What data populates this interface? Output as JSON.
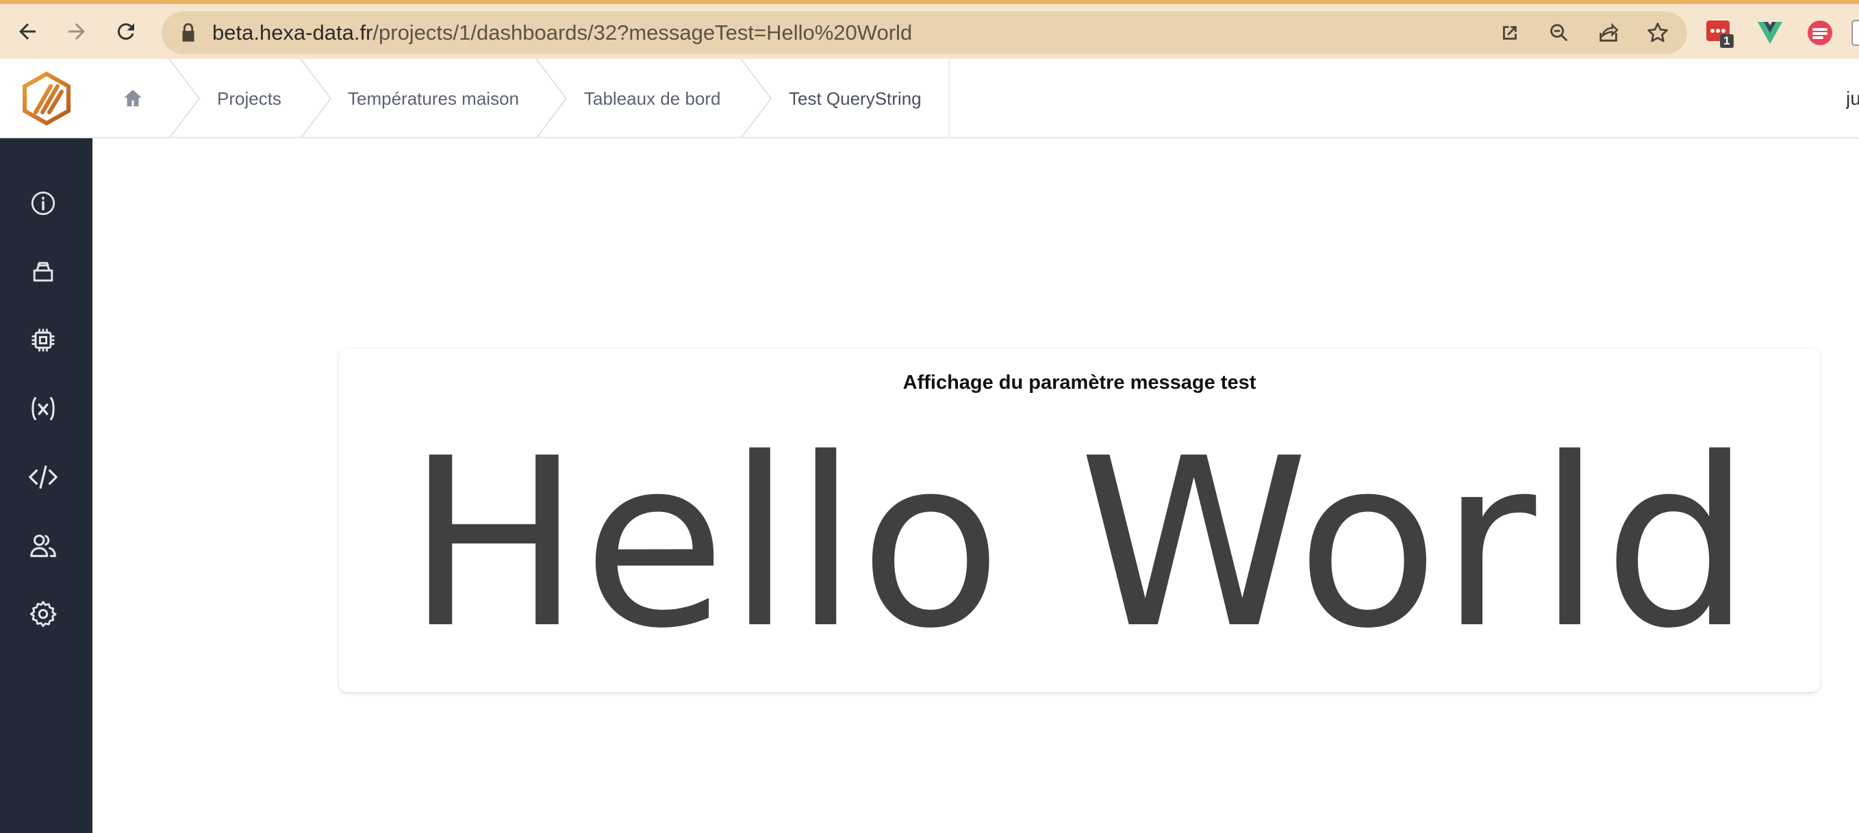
{
  "browser": {
    "url_host": "beta.hexa-data.fr",
    "url_path": "/projects/1/dashboards/32?messageTest=Hello%20World",
    "extension_badge": "1",
    "icons": [
      "back-icon",
      "forward-icon",
      "reload-icon",
      "lock-icon",
      "open-in-app-icon",
      "zoom-icon",
      "share-icon",
      "bookmark-star-icon"
    ]
  },
  "header": {
    "breadcrumbs": [
      {
        "label": "Projects"
      },
      {
        "label": "Températures maison"
      },
      {
        "label": "Tableaux de bord"
      },
      {
        "label": "Test QueryString"
      }
    ],
    "user_initial": "ju"
  },
  "sidebar": {
    "items": [
      {
        "icon": "info-icon"
      },
      {
        "icon": "database-icon"
      },
      {
        "icon": "chip-icon"
      },
      {
        "icon": "variable-icon"
      },
      {
        "icon": "code-icon"
      },
      {
        "icon": "users-icon"
      },
      {
        "icon": "gear-icon"
      }
    ]
  },
  "widget": {
    "title": "Affichage du paramètre message test",
    "value": "Hello World"
  },
  "colors": {
    "chrome_bg": "#f6e6cf",
    "chrome_accent": "#e8b25f",
    "sidebar_bg": "#222a38",
    "logo_orange": "#e07b1f",
    "value_text": "#404040"
  }
}
